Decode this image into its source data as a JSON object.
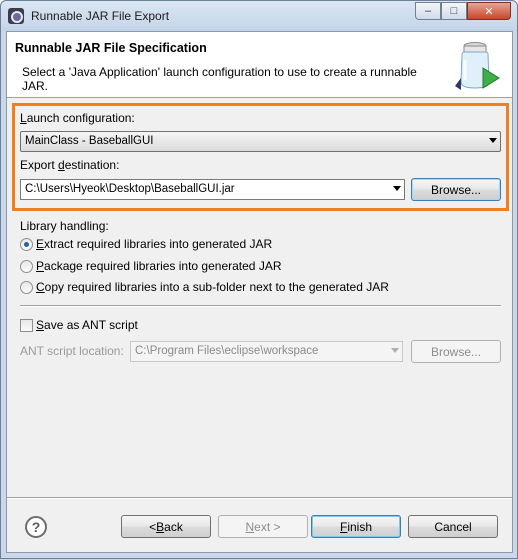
{
  "window": {
    "title": "Runnable JAR File Export",
    "controls": {
      "minimize": "–",
      "maximize": "□",
      "close": "✕"
    }
  },
  "header": {
    "title": "Runnable JAR File Specification",
    "description": "Select a 'Java Application' launch configuration to use to create a runnable JAR.",
    "icon": "jar-export-icon"
  },
  "launch_config": {
    "label_mnemonic": "L",
    "label_rest": "aunch configuration:",
    "value": "MainClass - BaseballGUI"
  },
  "export_destination": {
    "label_pre": "Export ",
    "label_mnemonic": "d",
    "label_rest": "estination:",
    "value": "C:\\Users\\Hyeok\\Desktop\\BaseballGUI.jar",
    "browse_label": "Browse..."
  },
  "library_handling": {
    "label": "Library handling:",
    "options": [
      {
        "mnemonic": "E",
        "rest": "xtract required libraries into generated JAR",
        "checked": true
      },
      {
        "mnemonic": "P",
        "rest": "ackage required libraries into generated JAR",
        "checked": false
      },
      {
        "mnemonic": "C",
        "rest": "opy required libraries into a sub-folder next to the generated JAR",
        "checked": false
      }
    ]
  },
  "ant": {
    "checkbox_mnemonic": "S",
    "checkbox_rest": "ave as ANT script",
    "checked": false,
    "location_label": "ANT script location:",
    "location_value": "C:\\Program Files\\eclipse\\workspace",
    "browse_label": "Browse..."
  },
  "footer": {
    "help_icon": "?",
    "back_pre": "< ",
    "back_mnemonic": "B",
    "back_rest": "ack",
    "next_pre": "",
    "next_mnemonic": "N",
    "next_rest": "ext >",
    "finish_mnemonic": "F",
    "finish_rest": "inish",
    "cancel_label": "Cancel"
  },
  "colors": {
    "highlight": "#f07f1e",
    "default_button_border": "#3c7fb1"
  }
}
